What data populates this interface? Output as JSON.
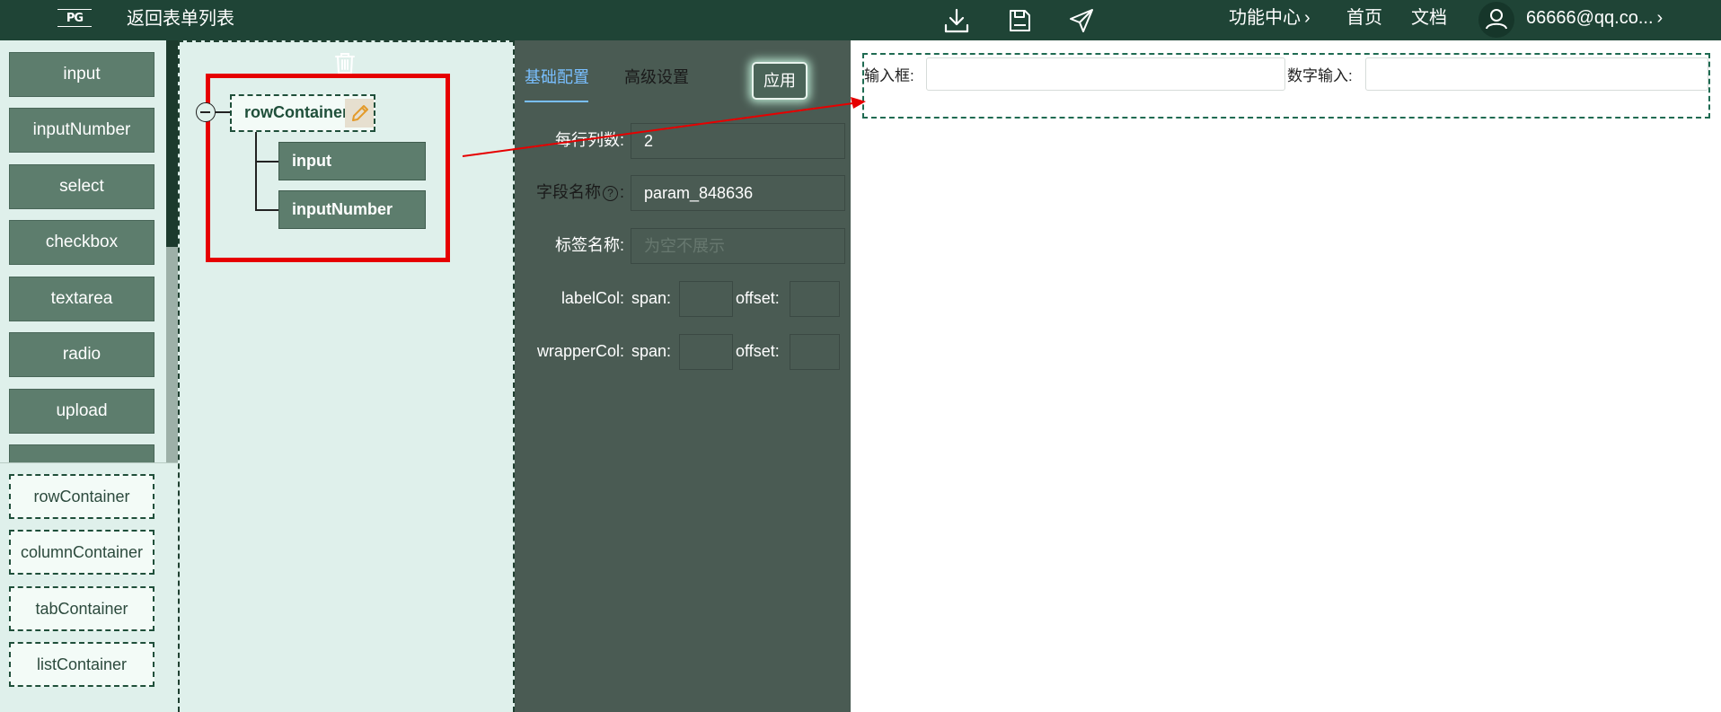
{
  "header": {
    "logo_text": "PG",
    "back_label": "返回表单列表",
    "nav": [
      {
        "label": "功能中心",
        "has_chevron": true
      },
      {
        "label": "首页",
        "has_chevron": false
      },
      {
        "label": "文档",
        "has_chevron": false
      }
    ],
    "user_email": "66666@qq.co...",
    "icons": [
      "download-icon",
      "save-icon",
      "send-icon",
      "user-icon",
      "chevron-right-icon"
    ]
  },
  "components": [
    "input",
    "inputNumber",
    "select",
    "checkbox",
    "textarea",
    "radio",
    "upload"
  ],
  "containers": [
    "rowContainer",
    "columnContainer",
    "tabContainer",
    "listContainer"
  ],
  "tree": {
    "root": "rowContainer",
    "children": [
      "input",
      "inputNumber"
    ]
  },
  "config": {
    "tabs": [
      {
        "label": "基础配置",
        "active": true
      },
      {
        "label": "高级设置",
        "active": false
      }
    ],
    "apply_label": "应用",
    "fields": {
      "columns": {
        "label": "每行列数",
        "value": "2"
      },
      "field_name": {
        "label": "字段名称",
        "value": "param_848636"
      },
      "label_name": {
        "label": "标签名称",
        "placeholder": "为空不展示"
      },
      "label_col": {
        "label": "labelCol",
        "span_label": "span",
        "offset_label": "offset"
      },
      "wrapper_col": {
        "label": "wrapperCol",
        "span_label": "span",
        "offset_label": "offset"
      }
    }
  },
  "preview": {
    "fields": [
      {
        "label": "输入框"
      },
      {
        "label": "数字输入"
      }
    ]
  },
  "colors": {
    "topbar": "#1f4436",
    "component_button": "#5d7d6d",
    "panel_bg": "#dff0eb",
    "config_bg": "#4a5b53",
    "active_tab": "#79bfff",
    "highlight_box": "#e60000"
  }
}
